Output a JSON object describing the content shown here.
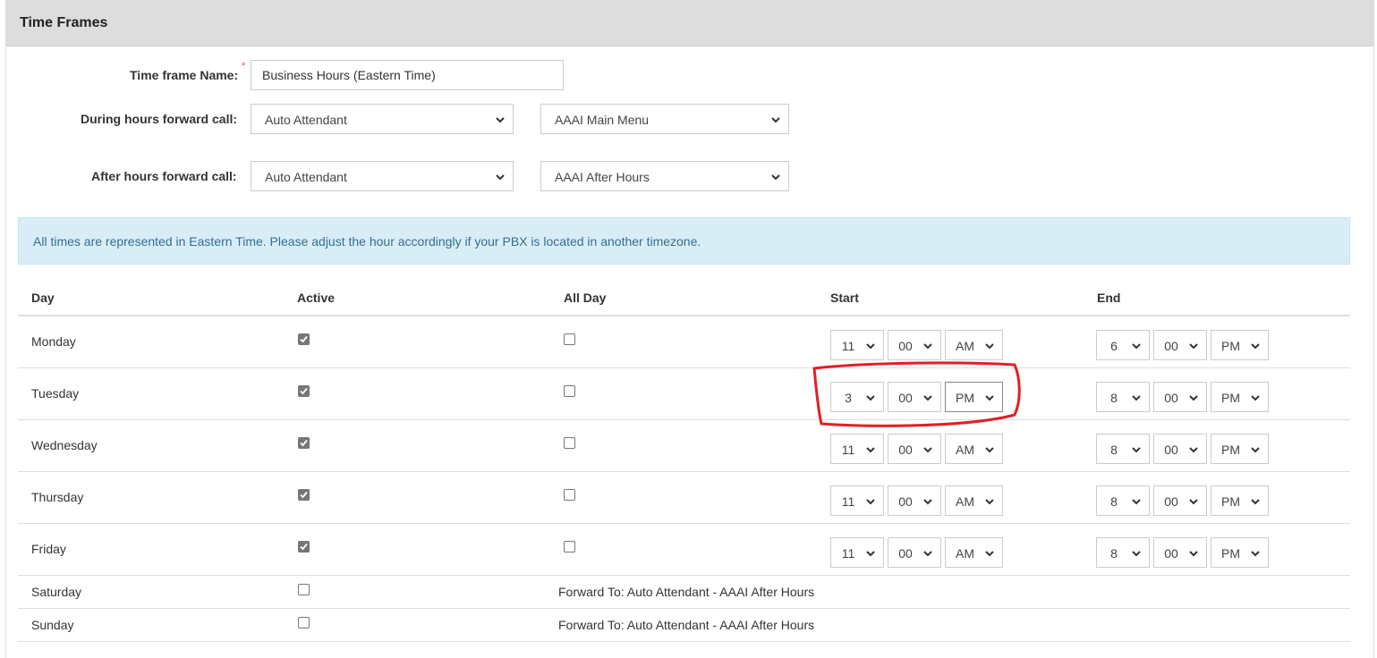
{
  "panel": {
    "title": "Time Frames"
  },
  "form": {
    "name_label": "Time frame Name:",
    "required_mark": "*",
    "name_value": "Business Hours (Eastern Time)",
    "during_label": "During hours forward call:",
    "during_type": "Auto Attendant",
    "during_target": "AAAI Main Menu",
    "after_label": "After hours forward call:",
    "after_type": "Auto Attendant",
    "after_target": "AAAI After Hours"
  },
  "alert": {
    "text": "All times are represented in Eastern Time. Please adjust the hour accordingly if your PBX is located in another timezone."
  },
  "table": {
    "headers": {
      "day": "Day",
      "active": "Active",
      "all_day": "All Day",
      "start": "Start",
      "end": "End"
    },
    "rows": [
      {
        "day": "Monday",
        "active": true,
        "all_day": false,
        "start": {
          "hour": "11",
          "min": "00",
          "ampm": "AM"
        },
        "end": {
          "hour": "6",
          "min": "00",
          "ampm": "PM"
        }
      },
      {
        "day": "Tuesday",
        "active": true,
        "all_day": false,
        "start": {
          "hour": "3",
          "min": "00",
          "ampm": "PM"
        },
        "end": {
          "hour": "8",
          "min": "00",
          "ampm": "PM"
        }
      },
      {
        "day": "Wednesday",
        "active": true,
        "all_day": false,
        "start": {
          "hour": "11",
          "min": "00",
          "ampm": "AM"
        },
        "end": {
          "hour": "8",
          "min": "00",
          "ampm": "PM"
        }
      },
      {
        "day": "Thursday",
        "active": true,
        "all_day": false,
        "start": {
          "hour": "11",
          "min": "00",
          "ampm": "AM"
        },
        "end": {
          "hour": "8",
          "min": "00",
          "ampm": "PM"
        }
      },
      {
        "day": "Friday",
        "active": true,
        "all_day": false,
        "start": {
          "hour": "11",
          "min": "00",
          "ampm": "AM"
        },
        "end": {
          "hour": "8",
          "min": "00",
          "ampm": "PM"
        }
      },
      {
        "day": "Saturday",
        "active": false,
        "forward_text": "Forward To: Auto Attendant - AAAI After Hours"
      },
      {
        "day": "Sunday",
        "active": false,
        "forward_text": "Forward To: Auto Attendant - AAAI After Hours"
      }
    ]
  },
  "colors": {
    "heading_bg": "#dddddd",
    "alert_bg": "#d9edf7",
    "alert_text": "#31708f",
    "required": "#d9534f",
    "annotation": "#e31e24"
  },
  "icons": {
    "select_arrow": "chevron-down-icon",
    "checkmark": "check-icon"
  }
}
